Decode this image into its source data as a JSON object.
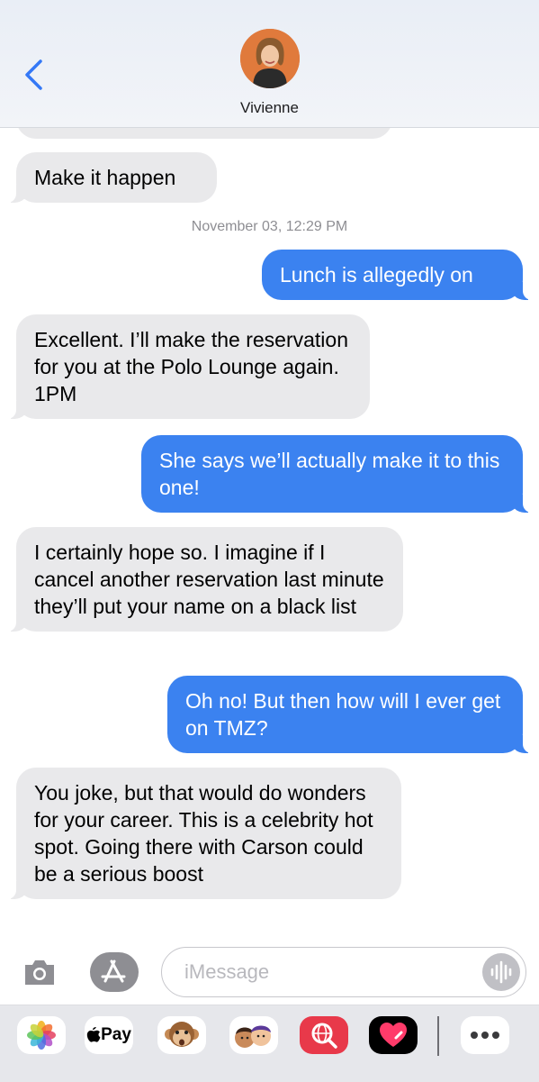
{
  "header": {
    "contact_name": "Vivienne"
  },
  "thread": {
    "timestamp": "November 03, 12:29 PM",
    "messages": [
      {
        "direction": "incoming",
        "text": "Make it happen"
      },
      {
        "direction": "outgoing",
        "text": "Lunch is allegedly on"
      },
      {
        "direction": "incoming",
        "text": "Excellent. I’ll make the reservation for you at the Polo Lounge again. 1PM"
      },
      {
        "direction": "outgoing",
        "text": "She says we’ll actually make it to this one!"
      },
      {
        "direction": "incoming",
        "text": "I certainly hope so. I imagine if I cancel another reservation last minute they’ll put your name on a black list"
      },
      {
        "direction": "outgoing",
        "text": "Oh no! But then how will I ever get on TMZ?"
      },
      {
        "direction": "incoming",
        "text": "You joke, but that would do wonders for your career. This is a celebrity hot spot. Going there with Carson could be a serious boost"
      }
    ]
  },
  "compose": {
    "placeholder": "iMessage",
    "icons": [
      "camera-icon",
      "app-store-icon",
      "audio-waveform-icon"
    ]
  },
  "app_drawer": {
    "apps": [
      "photos-icon",
      "apple-pay-icon",
      "monkey-memoji-icon",
      "memoji-icon",
      "web-search-icon",
      "digital-touch-icon",
      "more-icon"
    ],
    "apple_pay_label": "Pay"
  },
  "colors": {
    "outgoing_bubble": "#3b82f0",
    "incoming_bubble": "#e9e9eb",
    "accent": "#3478f6"
  }
}
